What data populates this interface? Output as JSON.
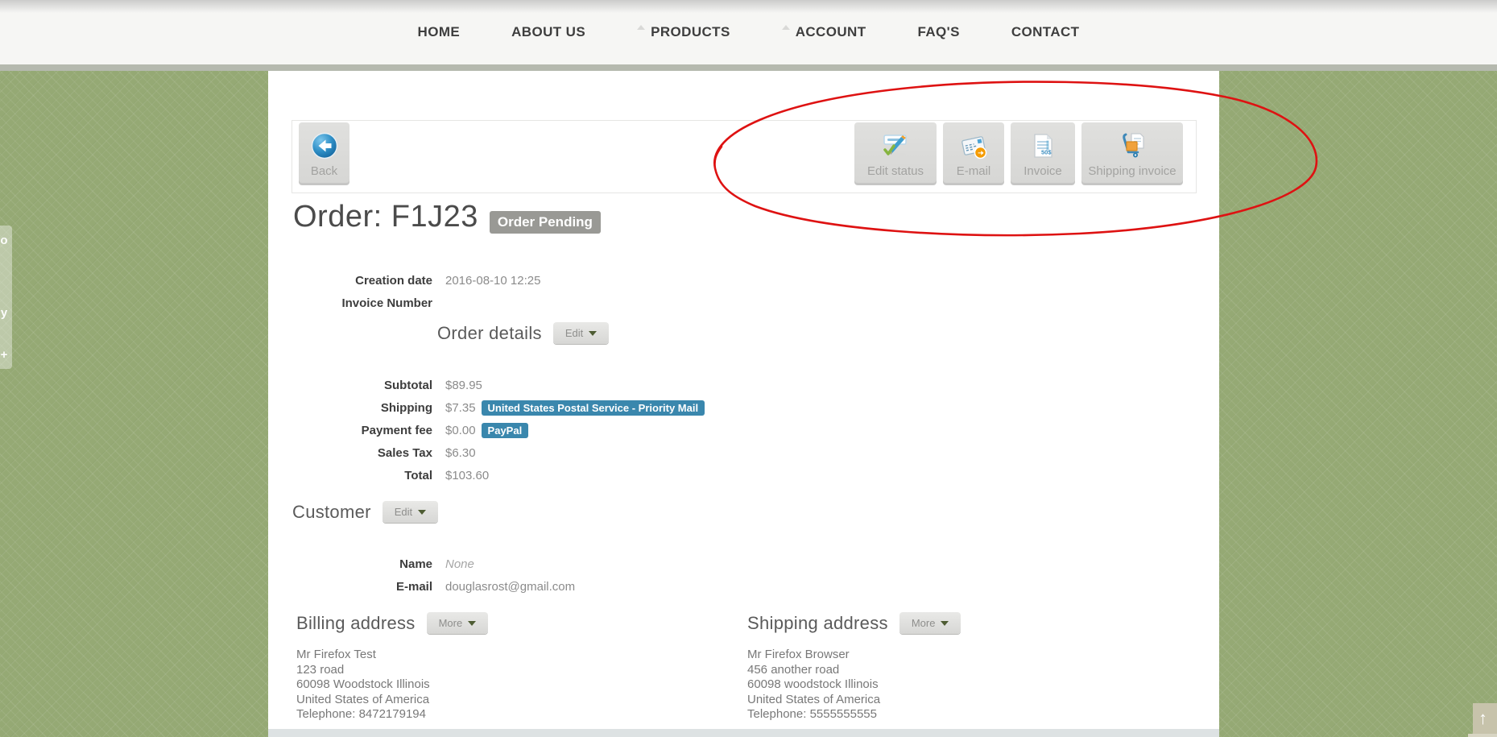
{
  "nav": {
    "items": [
      {
        "label": "HOME"
      },
      {
        "label": "ABOUT US"
      },
      {
        "label": "PRODUCTS"
      },
      {
        "label": "ACCOUNT"
      },
      {
        "label": "FAQ'S"
      },
      {
        "label": "CONTACT"
      }
    ]
  },
  "toolbar": {
    "back_label": "Back",
    "actions": [
      {
        "label": "Edit status",
        "icon": "edit-status-icon"
      },
      {
        "label": "E-mail",
        "icon": "email-icon"
      },
      {
        "label": "Invoice",
        "icon": "invoice-icon"
      },
      {
        "label": "Shipping invoice",
        "icon": "shipping-invoice-icon"
      }
    ]
  },
  "order": {
    "title": "Order: F1J23",
    "status_badge": "Order Pending",
    "meta": [
      {
        "label": "Creation date",
        "value": "2016-08-10 12:25"
      },
      {
        "label": "Invoice Number",
        "value": ""
      }
    ]
  },
  "order_details": {
    "heading": "Order details",
    "edit_button": "Edit",
    "rows": [
      {
        "label": "Subtotal",
        "value": "$89.95"
      },
      {
        "label": "Shipping",
        "value": "$7.35",
        "badge": "United States Postal Service - Priority Mail"
      },
      {
        "label": "Payment fee",
        "value": "$0.00",
        "badge": "PayPal"
      },
      {
        "label": "Sales Tax",
        "value": "$6.30"
      },
      {
        "label": "Total",
        "value": "$103.60"
      }
    ]
  },
  "customer": {
    "heading": "Customer",
    "edit_button": "Edit",
    "rows": [
      {
        "label": "Name",
        "value": "None"
      },
      {
        "label": "E-mail",
        "value": "douglasrost@gmail.com"
      }
    ]
  },
  "billing": {
    "heading": "Billing address",
    "more_button": "More",
    "lines": [
      "Mr Firefox Test",
      "123 road",
      "60098 Woodstock Illinois",
      "United States of America",
      "Telephone: 8472179194"
    ]
  },
  "shipping": {
    "heading": "Shipping address",
    "more_button": "More",
    "lines": [
      "Mr Firefox Browser",
      "456 another road",
      "60098 woodstock Illinois",
      "United States of America",
      "Telephone: 5555555555"
    ]
  },
  "share_tab": {
    "glyphs": [
      "o",
      "y",
      "+"
    ]
  },
  "scroll_top": {
    "arrow": "↑"
  },
  "colors": {
    "background_green": "#95a974",
    "badge_blue": "#3a87ad",
    "status_gray": "#999995",
    "annotation_red": "#de1212"
  }
}
